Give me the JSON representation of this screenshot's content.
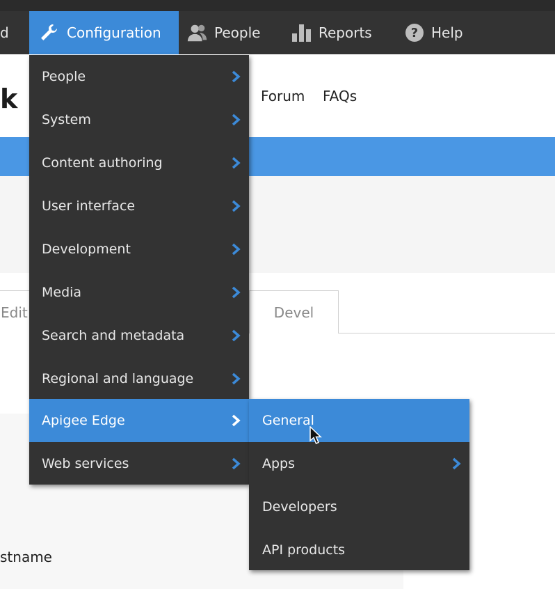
{
  "toolbar": {
    "cut_label": "d",
    "items": [
      {
        "label": "Configuration",
        "icon": "wrench-icon"
      },
      {
        "label": "People",
        "icon": "people-icon"
      },
      {
        "label": "Reports",
        "icon": "bar-chart-icon"
      },
      {
        "label": "Help",
        "icon": "help-icon"
      }
    ]
  },
  "page": {
    "title_fragment": "k",
    "nav": [
      "Forum",
      "FAQs"
    ],
    "tabs": [
      "Edit p",
      "Devel"
    ],
    "field_label": "stname"
  },
  "config_menu": {
    "items": [
      {
        "label": "People"
      },
      {
        "label": "System"
      },
      {
        "label": "Content authoring"
      },
      {
        "label": "User interface"
      },
      {
        "label": "Development"
      },
      {
        "label": "Media"
      },
      {
        "label": "Search and metadata"
      },
      {
        "label": "Regional and language"
      },
      {
        "label": "Apigee Edge",
        "active": true
      },
      {
        "label": "Web services"
      }
    ]
  },
  "apigee_submenu": {
    "items": [
      {
        "label": "General",
        "active": true
      },
      {
        "label": "Apps",
        "has_submenu": true
      },
      {
        "label": "Developers"
      },
      {
        "label": "API products"
      }
    ]
  },
  "colors": {
    "toolbar_bg": "#333333",
    "accent": "#3c8ad8",
    "chevron": "#3c8ad8"
  }
}
